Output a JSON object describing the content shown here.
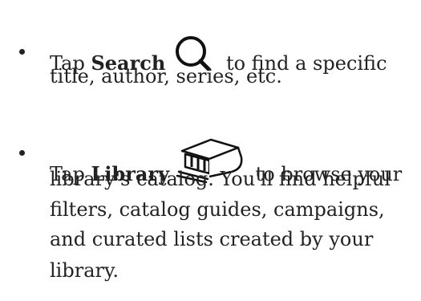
{
  "items": [
    {
      "prefix": "Tap ",
      "keyword": "Search",
      "icon": "search-icon",
      "line1_suffix": " to find a specific",
      "line2": "title, author, series, etc."
    },
    {
      "prefix": "Tap ",
      "keyword": "Library",
      "icon": "library-icon",
      "line1_suffix": " to browse your",
      "line2": "library's catalog. You'll find helpful",
      "line3": "filters, catalog guides, campaigns,",
      "line4": "and curated lists created by your",
      "line5": "library."
    }
  ]
}
